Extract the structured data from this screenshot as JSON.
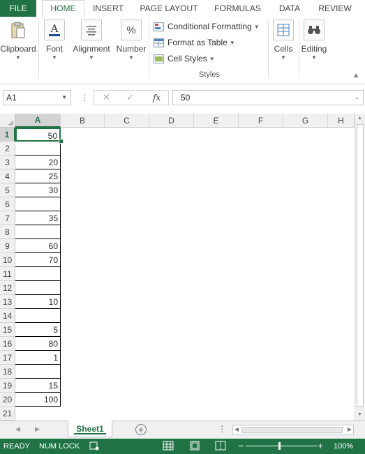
{
  "ribbon": {
    "file_tab": "FILE",
    "tabs": [
      "HOME",
      "INSERT",
      "PAGE LAYOUT",
      "FORMULAS",
      "DATA",
      "REVIEW"
    ],
    "active_tab": "HOME",
    "groups": {
      "clipboard": "Clipboard",
      "font": "Font",
      "alignment": "Alignment",
      "number": "Number",
      "cells": "Cells",
      "editing": "Editing"
    },
    "styles": {
      "conditional_formatting": "Conditional Formatting",
      "format_as_table": "Format as Table",
      "cell_styles": "Cell Styles",
      "group_label": "Styles"
    },
    "icons": {
      "clipboard": "paste-icon",
      "font": "font-color-icon",
      "alignment": "align-icon",
      "number": "percent-icon",
      "cells": "cells-icon",
      "editing": "binoculars-icon"
    }
  },
  "formula_bar": {
    "name_box": "A1",
    "formula": "50",
    "fx": "fx"
  },
  "grid": {
    "columns": [
      "A",
      "B",
      "C",
      "D",
      "E",
      "F",
      "G",
      "H"
    ],
    "selected_column": "A",
    "rows": [
      "1",
      "2",
      "3",
      "4",
      "5",
      "6",
      "7",
      "8",
      "9",
      "10",
      "11",
      "12",
      "13",
      "14",
      "15",
      "16",
      "17",
      "18",
      "19",
      "20",
      "21"
    ],
    "selected_row": "1",
    "column_a_values": [
      "50",
      "",
      "20",
      "25",
      "30",
      "",
      "35",
      "",
      "60",
      "70",
      "",
      "",
      "10",
      "",
      "5",
      "80",
      "1",
      "",
      "15",
      "100"
    ]
  },
  "sheets": {
    "active": "Sheet1"
  },
  "status": {
    "mode": "READY",
    "num_lock": "NUM LOCK",
    "zoom": "100%"
  },
  "colors": {
    "accent": "#217346"
  }
}
